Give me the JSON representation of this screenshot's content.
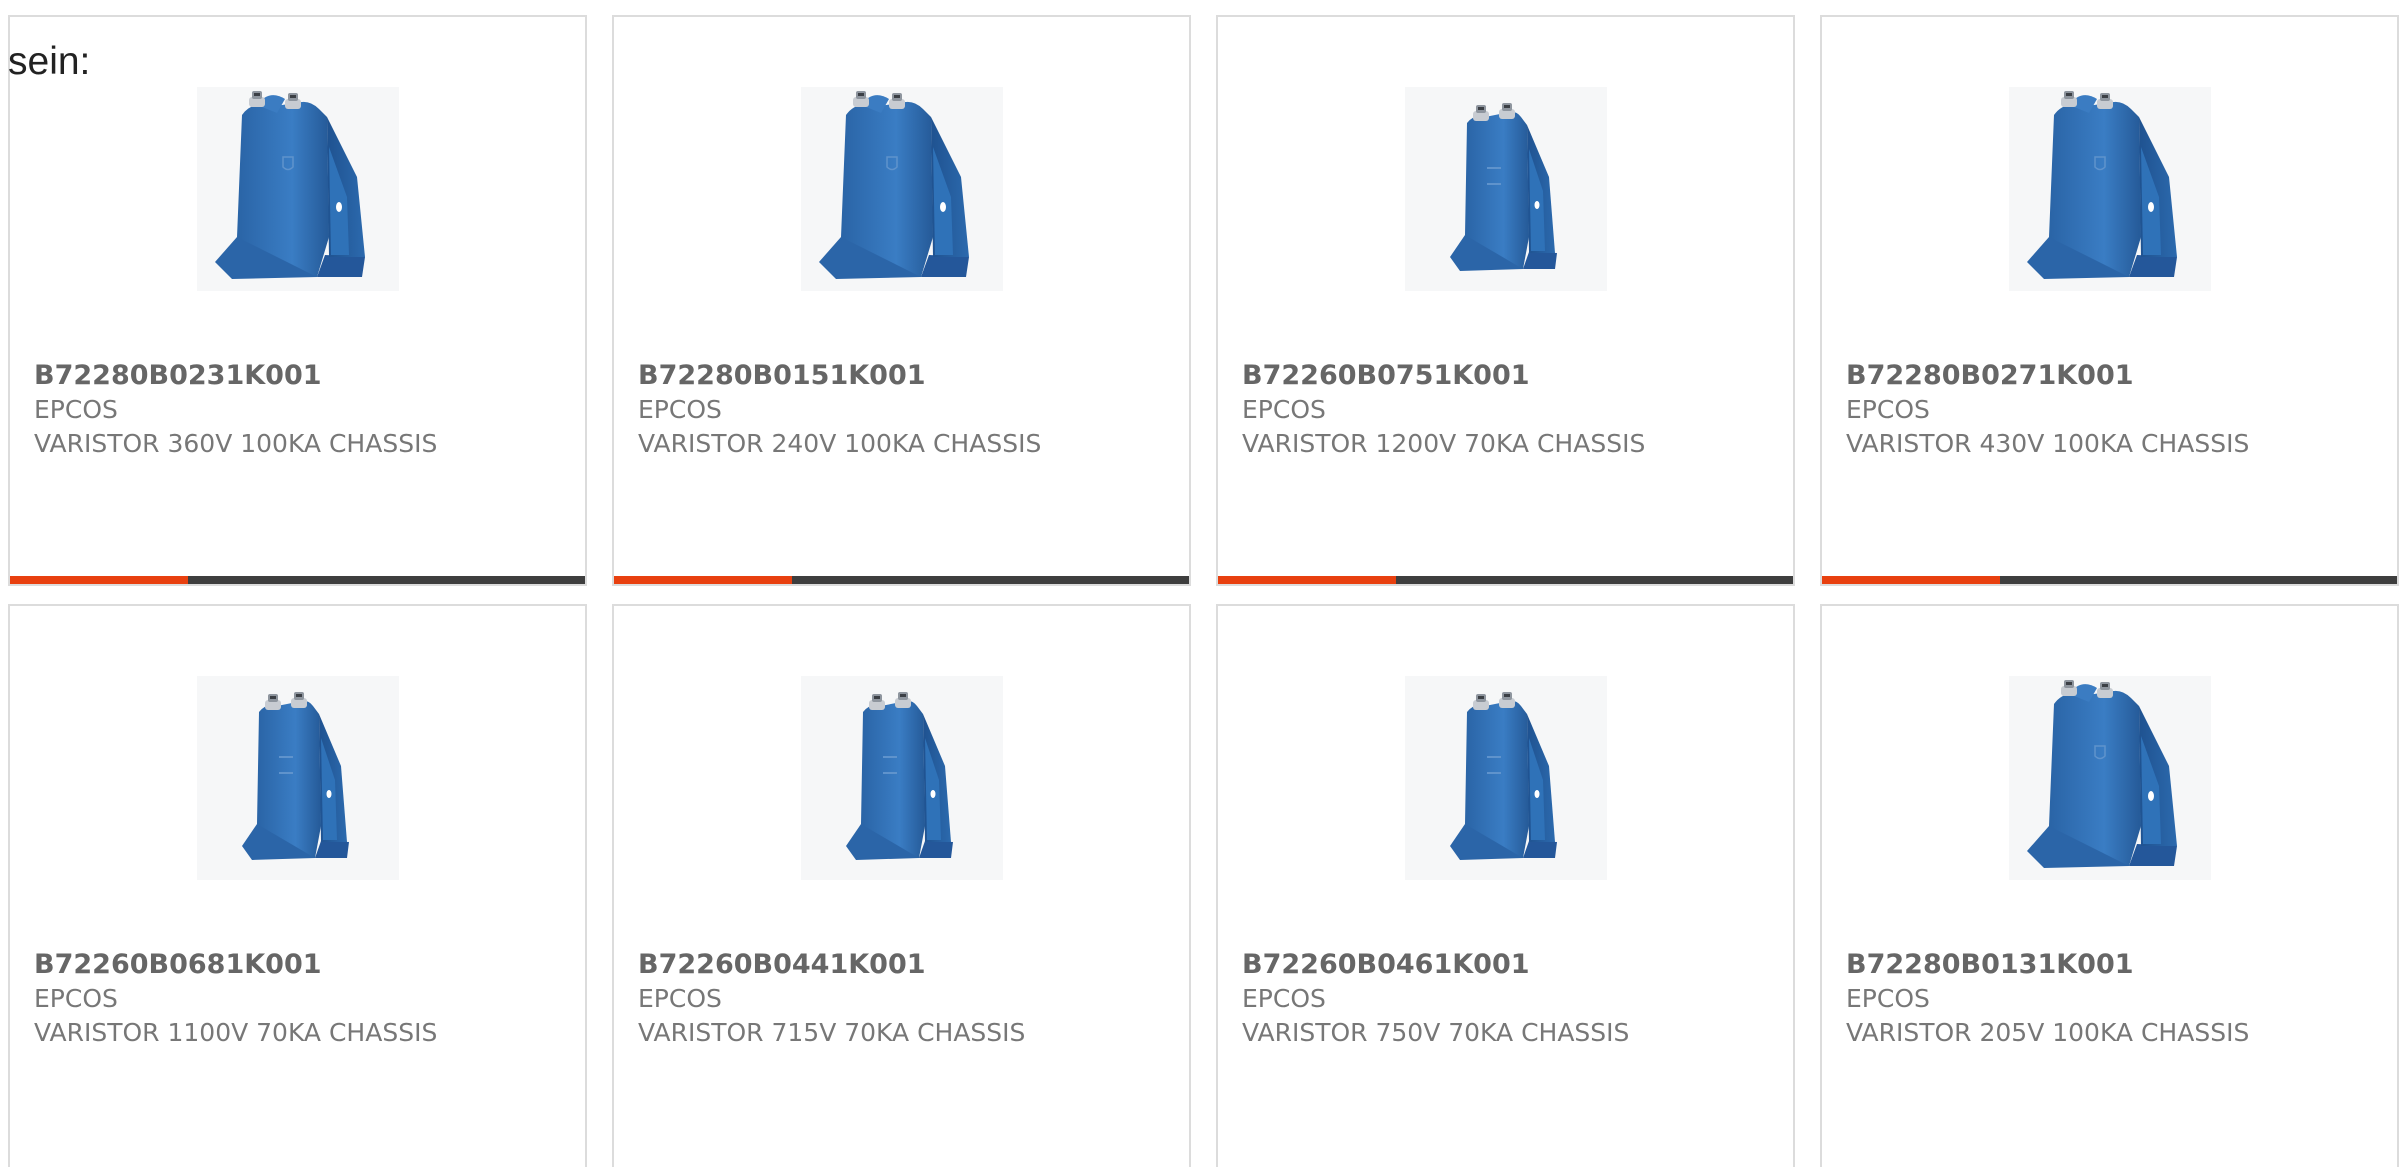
{
  "intro_text": "sein:",
  "colors": {
    "accent": "#e8400f",
    "bar_dark": "#3e3e3e",
    "product_blue": "#2f6fb0"
  },
  "products": [
    {
      "part_number": "B72280B0231K001",
      "manufacturer": "EPCOS",
      "description": "VARISTOR 360V 100KA CHASSIS",
      "image_icon": "varistor-product-image",
      "accent_fraction": 0.31
    },
    {
      "part_number": "B72280B0151K001",
      "manufacturer": "EPCOS",
      "description": "VARISTOR 240V 100KA CHASSIS",
      "image_icon": "varistor-product-image",
      "accent_fraction": 0.31
    },
    {
      "part_number": "B72260B0751K001",
      "manufacturer": "EPCOS",
      "description": "VARISTOR 1200V 70KA CHASSIS",
      "image_icon": "varistor-product-image",
      "accent_fraction": 0.31
    },
    {
      "part_number": "B72280B0271K001",
      "manufacturer": "EPCOS",
      "description": "VARISTOR 430V 100KA CHASSIS",
      "image_icon": "varistor-product-image",
      "accent_fraction": 0.31
    },
    {
      "part_number": "B72260B0681K001",
      "manufacturer": "EPCOS",
      "description": "VARISTOR 1100V 70KA CHASSIS",
      "image_icon": "varistor-product-image"
    },
    {
      "part_number": "B72260B0441K001",
      "manufacturer": "EPCOS",
      "description": "VARISTOR 715V 70KA CHASSIS",
      "image_icon": "varistor-product-image"
    },
    {
      "part_number": "B72260B0461K001",
      "manufacturer": "EPCOS",
      "description": "VARISTOR 750V 70KA CHASSIS",
      "image_icon": "varistor-product-image"
    },
    {
      "part_number": "B72280B0131K001",
      "manufacturer": "EPCOS",
      "description": "VARISTOR 205V 100KA CHASSIS",
      "image_icon": "varistor-product-image"
    }
  ]
}
